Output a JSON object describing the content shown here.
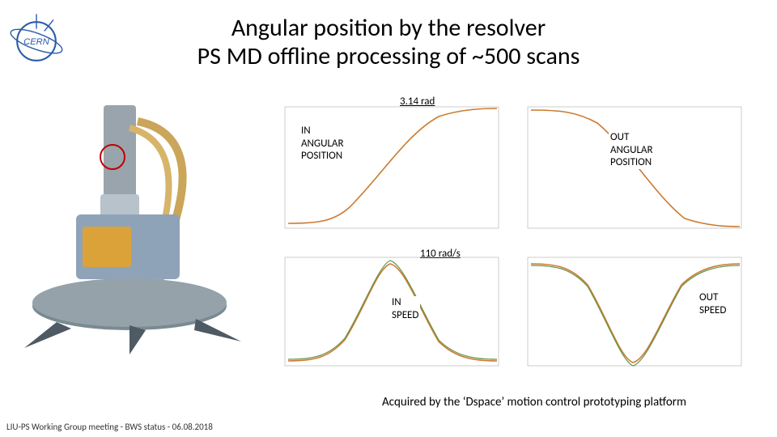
{
  "title_line1": "Angular position by the resolver",
  "title_line2": "PS MD offline processing of ~500 scans",
  "footer": "LIU-PS Working Group meeting - BWS status - 06.08.2018",
  "labels": {
    "top_value": "3.14 rad",
    "mid_value": "110 rad/s",
    "in_ang": "IN\nANGULAR\nPOSITION",
    "out_ang": "OUT\nANGULAR\nPOSITION",
    "in_speed": "IN\nSPEED",
    "out_speed": "OUT\nSPEED"
  },
  "caption": "Acquired by the ‘Dspace’ motion control prototyping platform",
  "logo_text": "CERN",
  "chart_data": [
    {
      "name": "in-angular-position",
      "type": "line",
      "xlabel": "",
      "ylabel": "",
      "x": [
        0.62,
        0.63,
        0.64,
        0.65,
        0.66,
        0.67,
        0.68,
        0.69,
        0.7,
        0.71,
        0.72,
        0.73,
        0.74,
        0.75
      ],
      "y": [
        0.0,
        0.02,
        0.1,
        0.3,
        0.7,
        1.2,
        1.7,
        2.2,
        2.6,
        2.9,
        3.05,
        3.12,
        3.14,
        3.14
      ],
      "xlim": [
        0.62,
        0.75
      ],
      "ylim": [
        0.0,
        3.2
      ],
      "peak_label": "3.14 rad"
    },
    {
      "name": "out-angular-position",
      "type": "line",
      "xlabel": "",
      "ylabel": "",
      "x": [
        1.05,
        1.06,
        1.07,
        1.08,
        1.09,
        1.1,
        1.11,
        1.12,
        1.13,
        1.14,
        1.15,
        1.16,
        1.17,
        1.18
      ],
      "y": [
        3.14,
        3.13,
        3.1,
        2.95,
        2.6,
        2.1,
        1.55,
        1.0,
        0.55,
        0.25,
        0.08,
        0.02,
        0.0,
        0.0
      ],
      "xlim": [
        1.05,
        1.18
      ],
      "ylim": [
        0.0,
        3.2
      ]
    },
    {
      "name": "in-speed",
      "type": "line",
      "xlabel": "",
      "ylabel": "",
      "x": [
        0.62,
        0.63,
        0.64,
        0.65,
        0.66,
        0.67,
        0.68,
        0.685,
        0.69,
        0.7,
        0.71,
        0.72,
        0.73,
        0.74,
        0.75
      ],
      "y": [
        0,
        2,
        10,
        30,
        60,
        90,
        105,
        110,
        106,
        88,
        60,
        30,
        10,
        2,
        0
      ],
      "xlim": [
        0.62,
        0.75
      ],
      "ylim": [
        0,
        120
      ],
      "peak_label": "110 rad/s"
    },
    {
      "name": "out-speed",
      "type": "line",
      "xlabel": "",
      "ylabel": "",
      "x": [
        1.05,
        1.06,
        1.07,
        1.08,
        1.09,
        1.1,
        1.11,
        1.115,
        1.12,
        1.13,
        1.14,
        1.15,
        1.16,
        1.17,
        1.18
      ],
      "y": [
        0,
        -2,
        -10,
        -30,
        -60,
        -90,
        -105,
        -110,
        -106,
        -88,
        -60,
        -30,
        -10,
        -2,
        0
      ],
      "xlim": [
        1.05,
        1.18
      ],
      "ylim": [
        -120,
        0
      ]
    }
  ],
  "model": {
    "description": "3D CAD rendering of BWS mechanism with resolver highlighted",
    "colors": {
      "hose": "#caa55a",
      "body": "#8fa3b8",
      "base": "#7a8a91",
      "shaft": "#9aa4ad",
      "blades": "#4e5a64",
      "accent1": "#c969c9",
      "accent2": "#3ea848"
    }
  }
}
